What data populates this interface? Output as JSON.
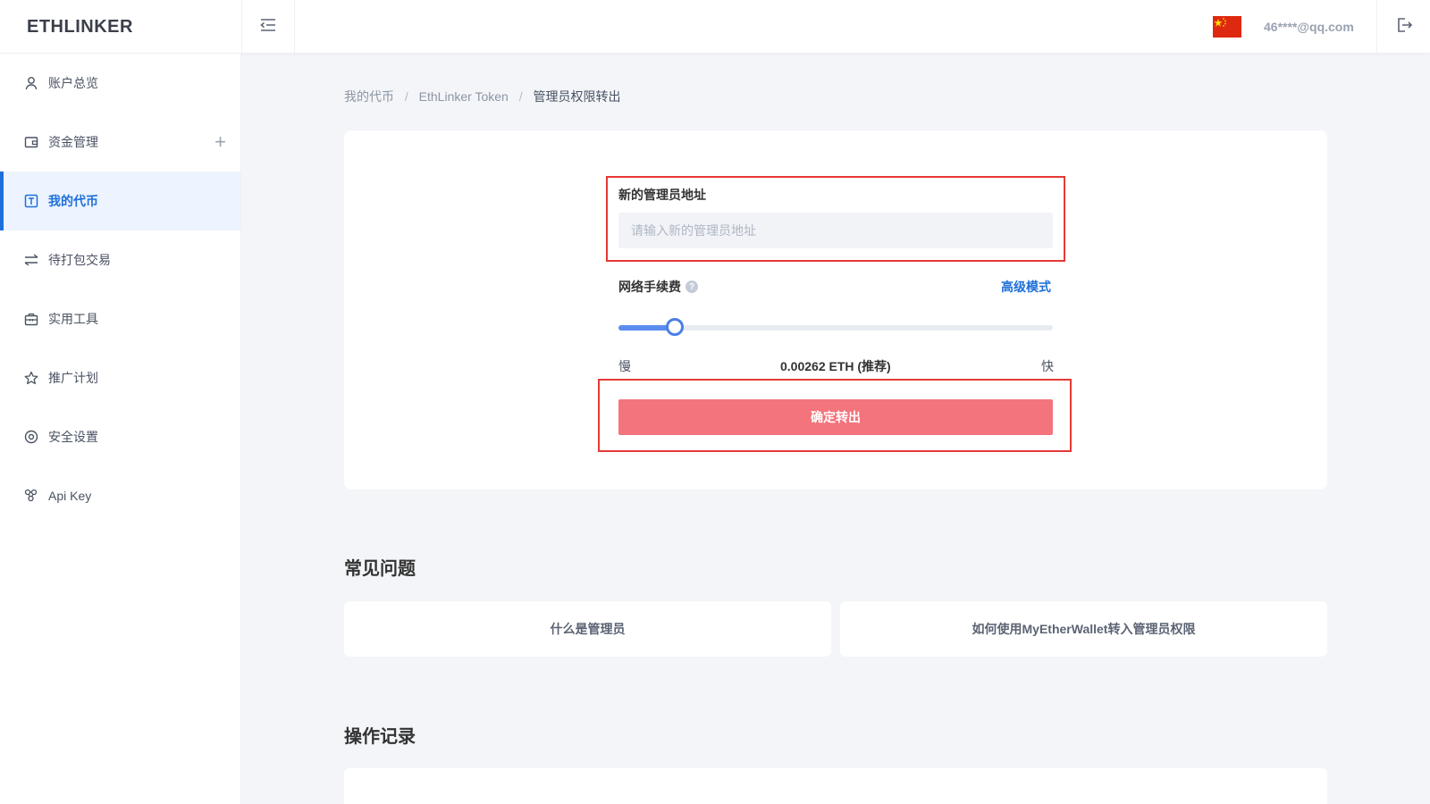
{
  "app": {
    "logo": "ETHLINKER",
    "user_email": "46****@qq.com",
    "language_flag": "china-flag-icon"
  },
  "sidebar": {
    "items": [
      {
        "label": "账户总览",
        "icon": "user-icon",
        "active": false
      },
      {
        "label": "资金管理",
        "icon": "wallet-icon",
        "active": false,
        "expand": "+"
      },
      {
        "label": "我的代币",
        "icon": "token-icon",
        "active": true
      },
      {
        "label": "待打包交易",
        "icon": "transfer-arrows-icon",
        "active": false
      },
      {
        "label": "实用工具",
        "icon": "toolbox-icon",
        "active": false
      },
      {
        "label": "推广计划",
        "icon": "star-icon",
        "active": false
      },
      {
        "label": "安全设置",
        "icon": "security-icon",
        "active": false
      },
      {
        "label": "Api Key",
        "icon": "api-key-icon",
        "active": false
      }
    ]
  },
  "breadcrumb": {
    "items": [
      "我的代币",
      "EthLinker Token"
    ],
    "current": "管理员权限转出",
    "separator": "/"
  },
  "form": {
    "address_label": "新的管理员地址",
    "address_placeholder": "请输入新的管理员地址",
    "address_value": "",
    "fee_label": "网络手续费",
    "help_glyph": "?",
    "advanced_mode": "高级模式",
    "fee_slider_fraction": 0.13,
    "slow_label": "慢",
    "fast_label": "快",
    "fee_value": "0.00262 ETH (推荐)",
    "confirm_button": "确定转出"
  },
  "faq": {
    "title": "常见问题",
    "items": [
      "什么是管理员",
      "如何使用MyEtherWallet转入管理员权限"
    ]
  },
  "records": {
    "title": "操作记录"
  },
  "colors": {
    "accent": "#1e6fd9",
    "slider": "#5b8def",
    "confirm_button": "#f3747c",
    "highlight_box": "#e53935",
    "flag": "#de2910"
  }
}
